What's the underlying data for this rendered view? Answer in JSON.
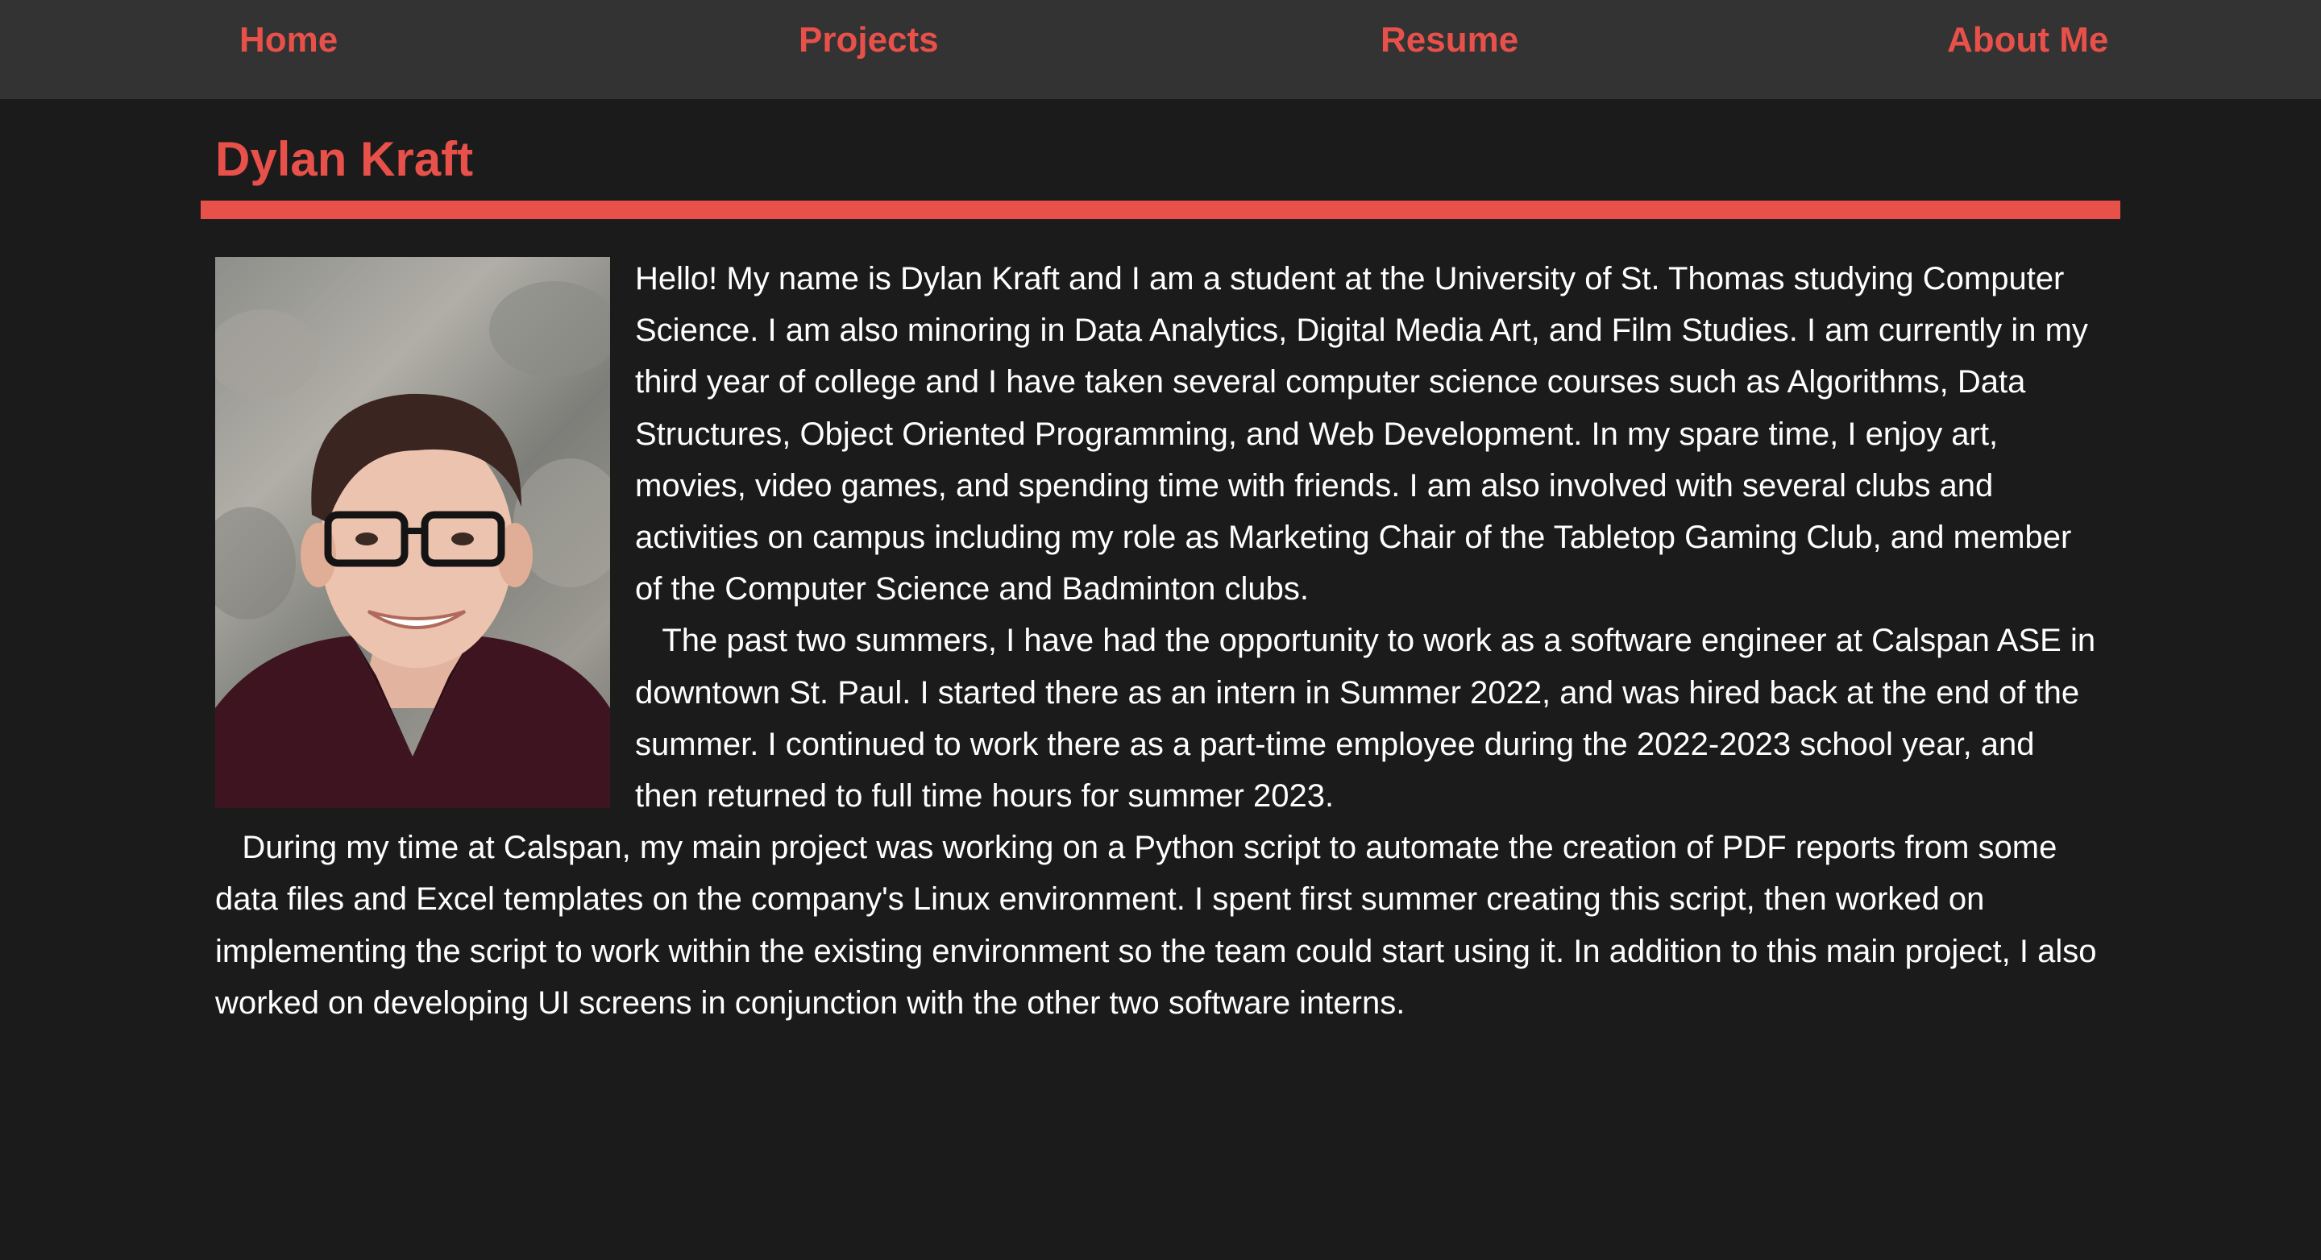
{
  "nav": {
    "home": "Home",
    "projects": "Projects",
    "resume": "Resume",
    "about": "About Me"
  },
  "header": {
    "title": "Dylan Kraft"
  },
  "bio": {
    "paragraphs": [
      "Hello! My name is Dylan Kraft and I am a student at the University of St. Thomas studying Computer Science. I am also minoring in Data Analytics, Digital Media Art, and Film Studies. I am currently in my third year of college and I have taken several computer science courses such as Algorithms, Data Structures, Object Oriented Programming, and Web Development. In my spare time, I enjoy art, movies, video games, and spending time with friends. I am also involved with several clubs and activities on campus including my role as Marketing Chair of the Tabletop Gaming Club, and member of the Computer Science and Badminton clubs.",
      "   The past two summers, I have had the opportunity to work as a software engineer at Calspan ASE in downtown St. Paul. I started there as an intern in Summer 2022, and was hired back at the end of the summer. I continued to work there as a part-time employee during the 2022-2023 school year, and then returned to full time hours for summer 2023.",
      "   During my time at Calspan, my main project was working on a Python script to automate the creation of PDF reports from some data files and Excel templates on the company's Linux environment. I spent first summer creating this script, then worked on implementing the script to work within the existing environment so the team could start using it. In addition to this main project, I also worked on developing UI screens in conjunction with the other two software interns."
    ]
  },
  "colors": {
    "accent": "#e8504a",
    "nav_bg": "#333333",
    "page_bg": "#1b1b1b",
    "text": "#ffffff"
  }
}
